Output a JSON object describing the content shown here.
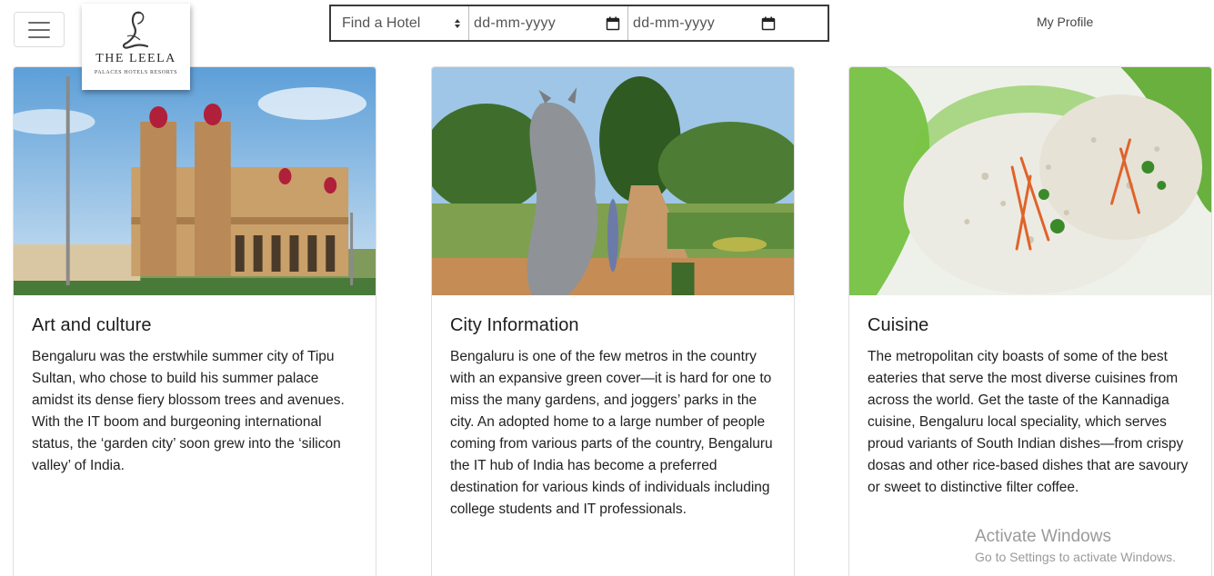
{
  "nav": {
    "menu_icon": "hamburger-icon",
    "profile_label": "My Profile"
  },
  "logo": {
    "brand": "THE LEELA",
    "tagline": "PALACES HOTELS RESORTS"
  },
  "search": {
    "hotel_select_value": "Find a Hotel",
    "hotel_select_icon": "sort-arrows-icon",
    "checkin_placeholder": "dd-mm-yyyy",
    "checkout_placeholder": "dd-mm-yyyy",
    "calendar_icon": "calendar-icon"
  },
  "cards": [
    {
      "title": "Art and culture",
      "text": "Bengaluru was the erstwhile summer city of Tipu Sultan, who chose to build his summer palace amidst its dense fiery blossom trees and avenues. With the IT boom and burgeoning international status, the ‘garden city’ soon grew into the ‘silicon valley’ of India."
    },
    {
      "title": "City Information",
      "text": "Bengaluru is one of the few metros in the country with an expansive green cover—it is hard for one to miss the many gardens, and joggers’ parks in the city. An adopted home to a large number of people coming from various parts of the country, Bengaluru the IT hub of India has become a preferred destination for various kinds of individuals including college students and IT professionals."
    },
    {
      "title": "Cuisine",
      "text": "The metropolitan city boasts of some of the best eateries that serve the most diverse cuisines from across the world. Get the taste of the Kannadiga cuisine, Bengaluru local speciality, which serves proud variants of South Indian dishes—from crispy dosas and other rice-based dishes that are savoury or sweet to distinctive filter coffee."
    }
  ],
  "watermark": {
    "line1": "Activate Windows",
    "line2": "Go to Settings to activate Windows."
  }
}
